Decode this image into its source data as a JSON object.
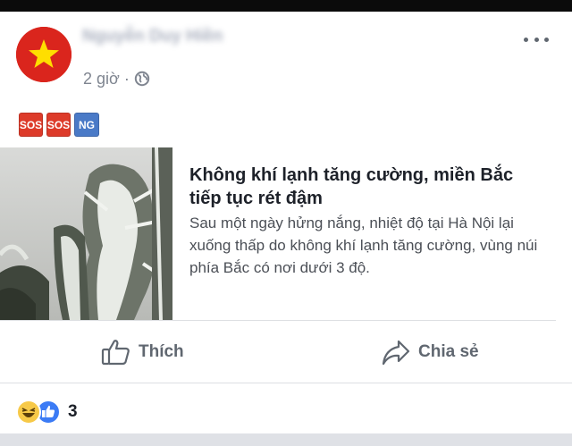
{
  "post": {
    "author_name": "Nguyễn Duy Hiền",
    "time": "2 giờ",
    "separator": "·",
    "privacy_icon": "globe-icon",
    "avatar_icon": "vietnam-flag-avatar",
    "more_icon": "more-horizontal-icon",
    "tags": [
      {
        "label": "SOS",
        "color": "#dd3b2a"
      },
      {
        "label": "SOS",
        "color": "#dd3b2a"
      },
      {
        "label": "NG",
        "color": "#4a7ac7"
      }
    ]
  },
  "link": {
    "title": "Không khí lạnh tăng cường, miền Bắc tiếp tục rét đậm",
    "description": "Sau một ngày hửng nắng, nhiệt độ tại Hà Nội lại xuống thấp do không khí lạnh tăng cường, vùng núi phía Bắc có nơi dưới 3 độ.",
    "image_icon": "frost-tree-photo"
  },
  "actions": {
    "like_label": "Thích",
    "like_icon": "thumbs-up-icon",
    "share_label": "Chia sẻ",
    "share_icon": "share-arrow-icon"
  },
  "reactions": {
    "icons": [
      "haha-icon",
      "like-icon"
    ],
    "count": "3"
  },
  "colors": {
    "like_blue": "#3b7bf5",
    "haha_yellow": "#f7c948",
    "flag_red": "#da251d",
    "flag_star": "#ffde00"
  }
}
